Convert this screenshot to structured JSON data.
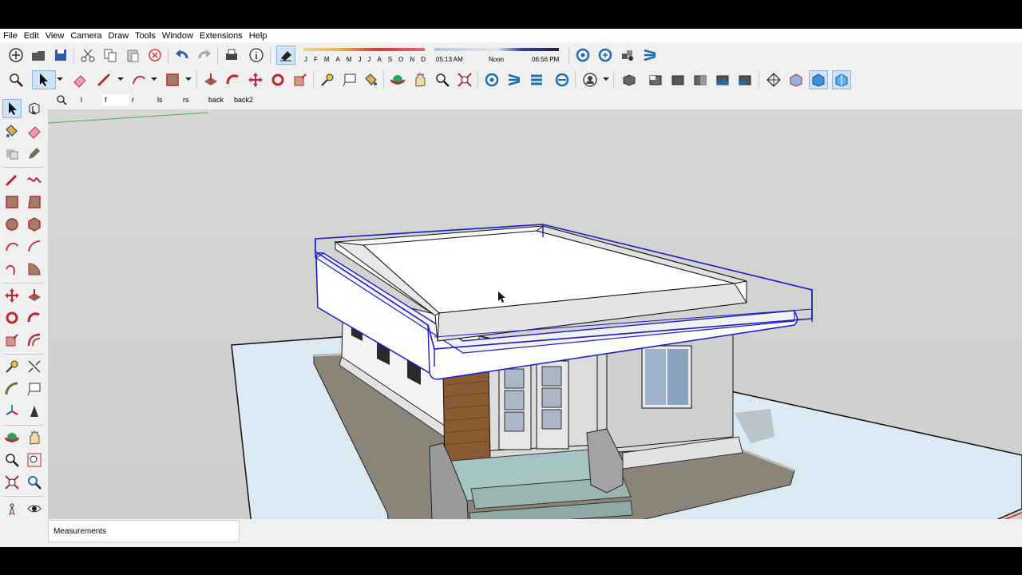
{
  "menu": [
    "File",
    "Edit",
    "View",
    "Camera",
    "Draw",
    "Tools",
    "Window",
    "Extensions",
    "Help"
  ],
  "shadow": {
    "months": [
      "J",
      "F",
      "M",
      "A",
      "M",
      "J",
      "J",
      "A",
      "S",
      "O",
      "N",
      "D"
    ],
    "time_start": "05:13 AM",
    "time_mid": "Noon",
    "time_end": "06:56 PM"
  },
  "scenes": [
    "l",
    "f",
    "r",
    "ls",
    "rs",
    "back",
    "back2"
  ],
  "active_scene_index": 1,
  "measurements_label": "Measurements",
  "icons_toolbar1": [
    "new-icon",
    "open-icon",
    "save-icon",
    "cut-icon",
    "copy-icon",
    "paste-icon",
    "erase-icon",
    "undo-icon",
    "redo-icon",
    "print-icon",
    "model-info-icon",
    "shadows-toggle-icon",
    "warehouse-icon",
    "warehouse-share-icon",
    "extension-warehouse-icon",
    "layout-icon"
  ],
  "icons_toolbar2": [
    "zoom-icon",
    "select-icon",
    "eraser-icon",
    "line-icon",
    "arc-icon",
    "rectangle-icon",
    "push-pull-icon",
    "follow-me-icon",
    "move-icon",
    "rotate-icon",
    "scale-icon",
    "tape-measure-icon",
    "text-icon",
    "paint-bucket-icon",
    "orbit-icon",
    "pan-icon",
    "zoom-window-icon",
    "zoom-extents-icon",
    "warehouse-icon",
    "share-model-icon",
    "components-icon",
    "extensions-icon",
    "profile-icon",
    "iso-view-icon",
    "top-view-icon",
    "front-view-icon",
    "right-view-icon",
    "back-view-icon",
    "left-view-icon",
    "xray-icon",
    "wireframe-icon",
    "hidden-line-icon",
    "shaded-icon",
    "textured-icon"
  ],
  "colors": {
    "selection": "#1a1acc",
    "sky": "#d1d1cf",
    "ground": "#dbe9f2",
    "accent_red": "#d43a3a"
  }
}
